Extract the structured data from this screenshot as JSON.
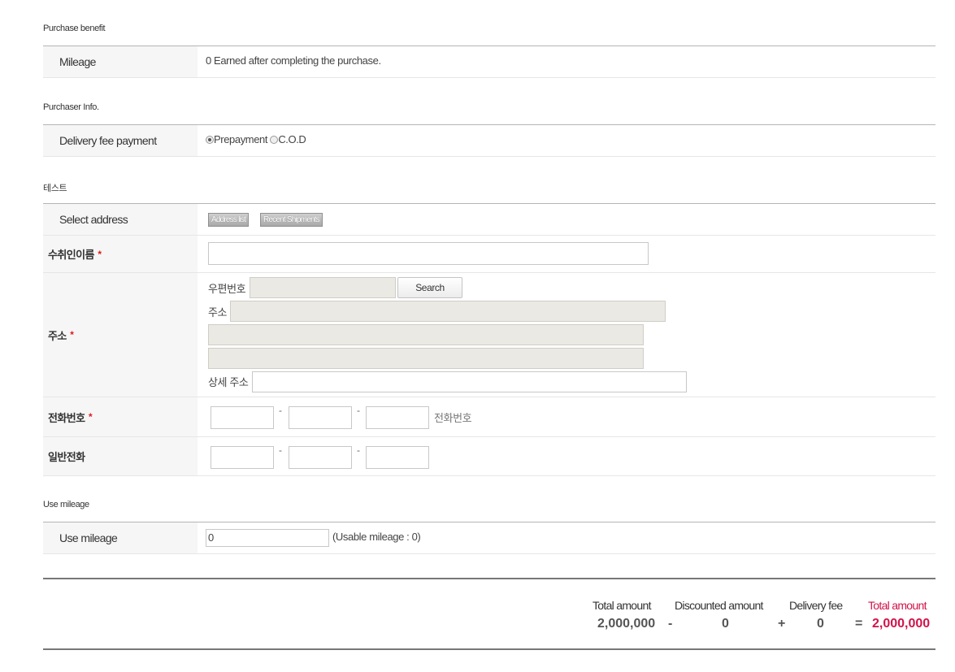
{
  "benefit": {
    "section_title": "Purchase benefit",
    "mileage_label": "Mileage",
    "mileage_text": "0 Earned after completing the purchase."
  },
  "purchaser": {
    "section_title": "Purchaser Info.",
    "delivery_label": "Delivery fee payment",
    "options": [
      "Prepayment",
      "C.O.D"
    ],
    "selected": "Prepayment"
  },
  "shipping": {
    "section_title": "테스트",
    "select_address_label": "Select address",
    "address_list_button": "Address list",
    "recent_shipments_button": "Recent Shipments",
    "recipient_label": "수취인이름",
    "required_mark": "*",
    "address_label": "주소",
    "postcode_label": "우편번호",
    "search_button": "Search",
    "addr_label": "주소",
    "detail_label": "상세 주소",
    "phone_label": "전화번호",
    "phone_hint": "전화번호",
    "landline_label": "일반전화",
    "dash": "-"
  },
  "use_mileage": {
    "section_title": "Use mileage",
    "label": "Use mileage",
    "value": "0",
    "usable_text": "(Usable mileage : 0)"
  },
  "summary": {
    "total_label": "Total amount",
    "total_value": "2,000,000",
    "discount_label": "Discounted amount",
    "discount_value": "0",
    "delivery_label": "Delivery fee",
    "delivery_value": "0",
    "grand_label": "Total amount",
    "grand_value": "2,000,000",
    "op_minus": "-",
    "op_plus": "+",
    "op_equals": "=",
    "accent_color": "#d2134a"
  }
}
